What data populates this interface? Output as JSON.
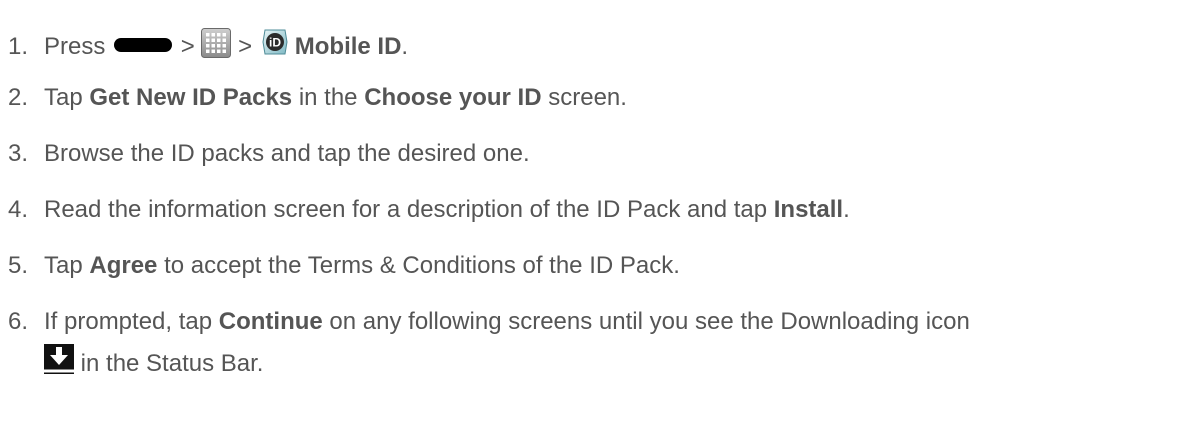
{
  "steps": [
    {
      "num": "1.",
      "press": "Press",
      "sep1": ">",
      "sep2": ">",
      "app_name": "Mobile ID",
      "end": "."
    },
    {
      "num": "2.",
      "t1": "Tap",
      "b1": "Get New ID Packs",
      "t2": "in the",
      "b2": "Choose your ID",
      "t3": "screen."
    },
    {
      "num": "3.",
      "t1": "Browse the ID packs and tap the desired one."
    },
    {
      "num": "4.",
      "t1": "Read the information screen for a description of the ID Pack and tap",
      "b1": "Install",
      "t2": "."
    },
    {
      "num": "5.",
      "t1": "Tap",
      "b1": "Agree",
      "t2": "to accept the Terms & Conditions of the ID Pack."
    },
    {
      "num": "6.",
      "t1": "If prompted, tap",
      "b1": "Continue",
      "t2": "on any following screens until you see the Downloading icon",
      "t3": "in the Status Bar."
    }
  ],
  "icons": {
    "home_key": "home-key-icon",
    "apps": "apps-grid-icon",
    "mobile_id": "mobile-id-icon",
    "downloading": "download-icon"
  }
}
